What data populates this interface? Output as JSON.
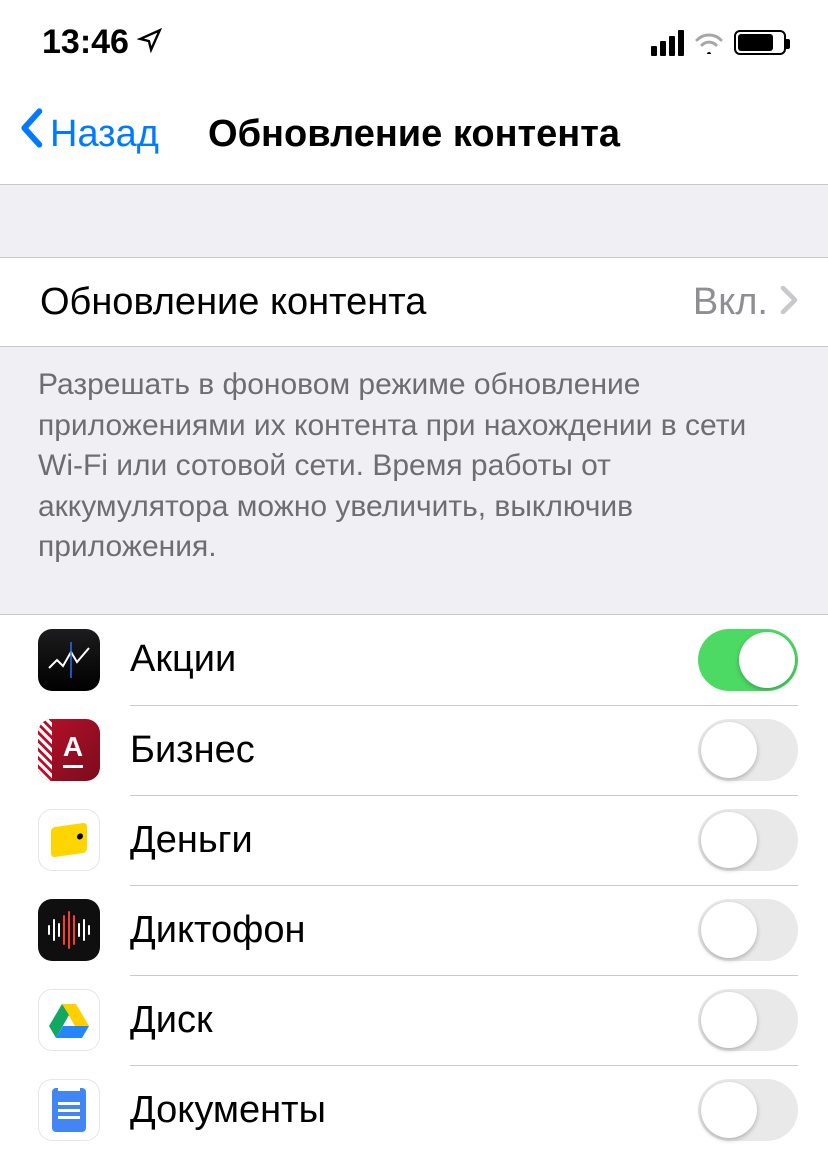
{
  "status": {
    "time": "13:46"
  },
  "nav": {
    "back": "Назад",
    "title": "Обновление контента"
  },
  "refresh": {
    "label": "Обновление контента",
    "value": "Вкл."
  },
  "footer": "Разрешать в фоновом режиме обновление приложениями их контента при нахождении в сети Wi-Fi или сотовой сети. Время работы от аккумулятора можно увеличить, выключив приложения.",
  "apps": [
    {
      "name": "Акции",
      "enabled": true
    },
    {
      "name": "Бизнес",
      "enabled": false
    },
    {
      "name": "Деньги",
      "enabled": false
    },
    {
      "name": "Диктофон",
      "enabled": false
    },
    {
      "name": "Диск",
      "enabled": false
    },
    {
      "name": "Документы",
      "enabled": false
    }
  ]
}
